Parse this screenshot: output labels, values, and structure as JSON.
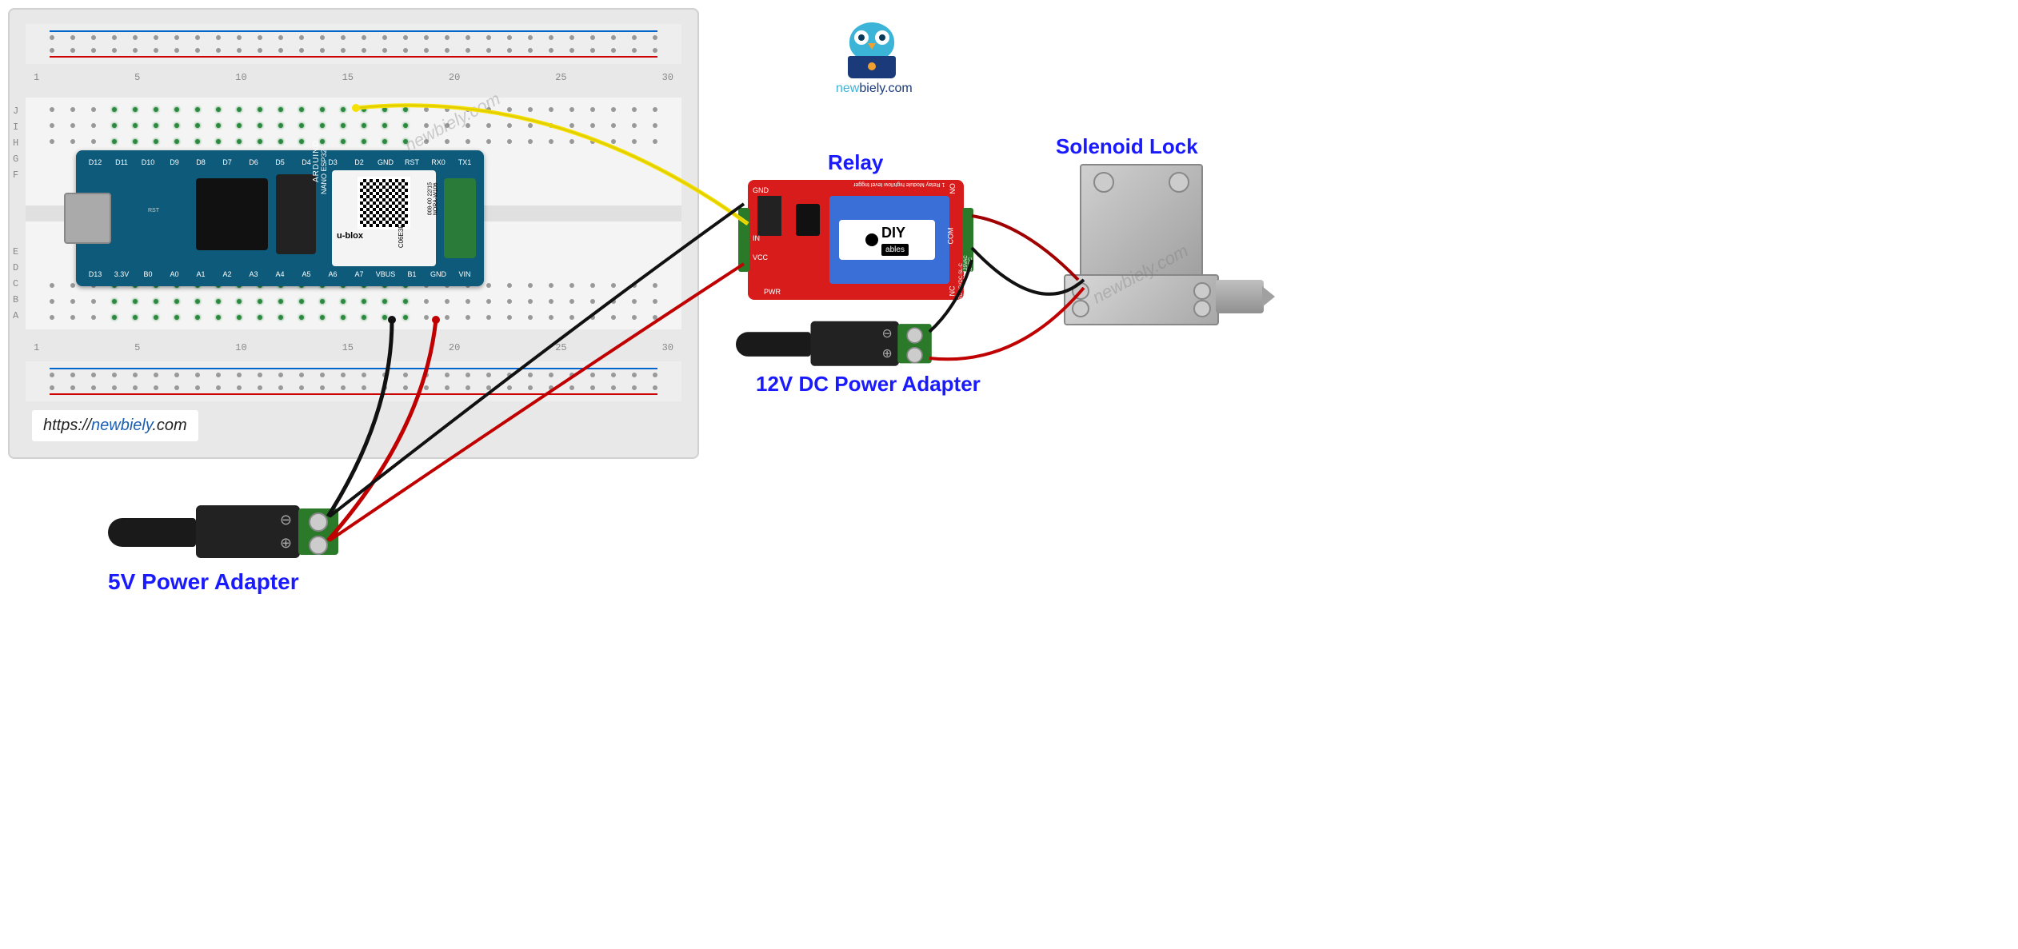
{
  "site": {
    "url_prefix": "https://",
    "url_brand": "newbiely",
    "url_suffix": ".com",
    "brand_full": "newbiely.com"
  },
  "breadboard": {
    "columns": [
      "1",
      "5",
      "10",
      "15",
      "20",
      "25",
      "30"
    ],
    "rows_top": [
      "J",
      "I",
      "H",
      "G",
      "F"
    ],
    "rows_bottom": [
      "E",
      "D",
      "C",
      "B",
      "A"
    ]
  },
  "arduino": {
    "name_line1": "NANO",
    "name_line2": "ESP32",
    "logo": "ARDUINO",
    "module_brand": "u-blox",
    "module_code": "C06E3F",
    "module_serial": "008-00 22/15",
    "module_model": "NORA-W106",
    "pins_top": [
      "D12",
      "D11",
      "D10",
      "D9",
      "D8",
      "D7",
      "D6",
      "D5",
      "D4",
      "D3",
      "D2",
      "GND",
      "RST",
      "RX0",
      "TX1"
    ],
    "pins_bottom": [
      "D13",
      "3.3V",
      "B0",
      "A0",
      "A1",
      "A2",
      "A3",
      "A4",
      "A5",
      "A6",
      "A7",
      "VBUS",
      "B1",
      "GND",
      "VIN"
    ],
    "reset_label": "RST"
  },
  "relay": {
    "title": "Relay",
    "module_text_1": "1 Relay Module",
    "module_text_2": "high/low level trigger",
    "spec_line1": "SRD-05VDC-SL-C",
    "spec_line2": "10A 250VAC 10A 125VAC",
    "spec_line3": "10A 30VDC 10A 28VDC",
    "tag_brand": "DIY",
    "tag_sub": "ables",
    "pins_left": [
      "GND",
      "IN",
      "VCC"
    ],
    "pins_right": [
      "NO",
      "COM",
      "NC"
    ],
    "pwr_label": "PWR"
  },
  "solenoid": {
    "title": "Solenoid Lock"
  },
  "power": {
    "five_v": "5V Power Adapter",
    "twelve_v": "12V DC Power Adapter",
    "minus": "⊖",
    "plus": "⊕"
  },
  "watermark": "newbiely.com"
}
